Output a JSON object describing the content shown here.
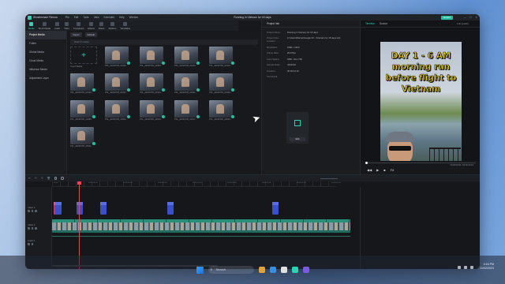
{
  "app": {
    "name": "Wondershare Filmora",
    "menu": [
      "File",
      "Edit",
      "Tools",
      "View",
      "Extended",
      "Help",
      "Window"
    ],
    "project_title": "Running in Vietnam for 15 days",
    "export_label": "Export"
  },
  "toolbar": {
    "tools": [
      "Media",
      "Stock Media",
      "Audio",
      "Titles",
      "Transitions",
      "Effects",
      "Filters",
      "Stickers",
      "Templates"
    ]
  },
  "sidebar": {
    "items": [
      "Project Media",
      "Folder",
      "Global Media",
      "Cloud Media",
      "Influence Media",
      "Adjustment Layer"
    ]
  },
  "media": {
    "import_label": "Import",
    "default_label": "Default",
    "search_placeholder": "Search media",
    "import_caption": "Import Media",
    "files": [
      "PXL_20230705_22392...",
      "PXL_20230705_22400...",
      "PXL_20230705_22403...",
      "PXL_20230705_22413...",
      "PXL_20230705_22418...",
      "PXL_20230705_22427...",
      "PXL_20230705_22434...",
      "PXL_20230705_22441...",
      "PXL_20230705_22449...",
      "PXL_20230705_22455...",
      "PXL_20230705_22502...",
      "PXL_20230705_22510...",
      "PXL_20230705_22517...",
      "PXL_20230705_22523...",
      "PXL_20230705_22531..."
    ]
  },
  "project_info": {
    "heading": "Project Info",
    "rows": [
      {
        "key": "Project Name:",
        "value": "Running in Vietnam for 15 days"
      },
      {
        "key": "Project Files Location:",
        "value": "C:\\Users\\Marcel\\Google Dri...\\Vietnam for 15 days.wfp"
      },
      {
        "key": "Resolution:",
        "value": "1080 x 1920"
      },
      {
        "key": "Frame Rate:",
        "value": "29.97fps"
      },
      {
        "key": "Color Space:",
        "value": "SDR - Rec.709"
      },
      {
        "key": "Sample Rate:",
        "value": "44100Hz"
      },
      {
        "key": "Duration:",
        "value": "00:00:44:16"
      },
      {
        "key": "Thumbnail:",
        "value": ""
      }
    ],
    "edit_label": "Edit"
  },
  "player": {
    "tabs": [
      "Timeline",
      "Source"
    ],
    "quality": "Full Quality",
    "caption_lines": [
      "DAY 1 - 6 AM",
      "morning run",
      "before flight to",
      "Vietnam"
    ],
    "current_time": "00:00:00:00",
    "total_time": "00:00:44:16",
    "zoom": "Fit"
  },
  "timeline": {
    "ruler_ticks": [
      "00:00",
      "00:00:05:00",
      "00:00:10:00",
      "00:00:15:00",
      "00:00:20:00",
      "00:00:25:00",
      "00:00:30:00",
      "00:00:35:00",
      "00:00:40:00"
    ],
    "tracks": [
      "Video 2",
      "Video 1",
      "Audio 1"
    ]
  },
  "taskbar": {
    "search_placeholder": "Search",
    "time": "4:16 PM",
    "date": "11/02/2023"
  },
  "colors": {
    "accent": "#2bd4b3",
    "title_clip": "#3a4fc9",
    "video_clip": "#1f6e5d",
    "caption_text": "#f2d11d",
    "playhead": "#e04a5a"
  }
}
